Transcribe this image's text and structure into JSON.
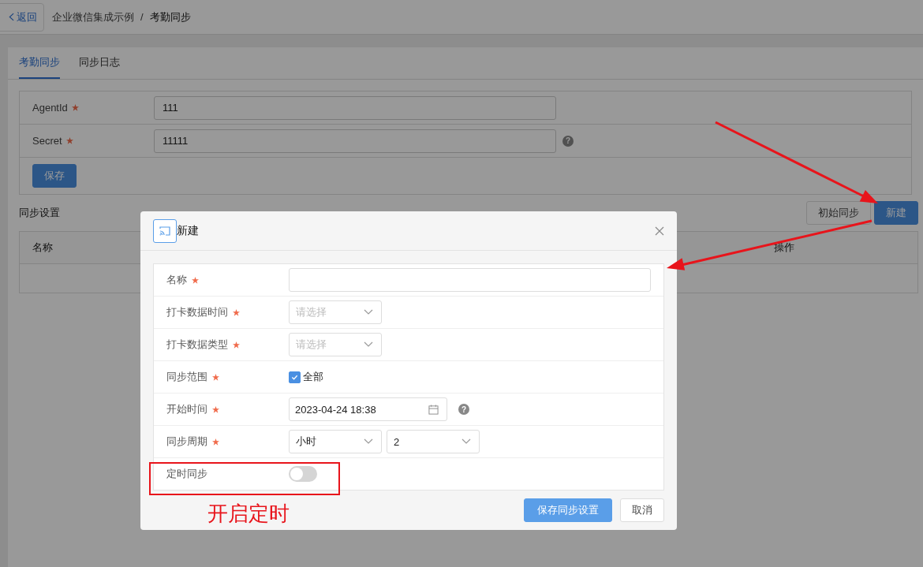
{
  "header": {
    "back": "返回",
    "breadcrumb": [
      "企业微信集成示例",
      "考勤同步"
    ],
    "separator": "/"
  },
  "tabs": [
    {
      "label": "考勤同步",
      "selected": true
    },
    {
      "label": "同步日志",
      "selected": false
    }
  ],
  "credentials": {
    "fields": [
      {
        "label": "AgentId",
        "required": true,
        "value": "111"
      },
      {
        "label": "Secret",
        "required": true,
        "value": "11111",
        "help": "?"
      }
    ],
    "save_button": "保存"
  },
  "sync_settings": {
    "title": "同步设置",
    "buttons": [
      {
        "label": "初始同步",
        "kind": "default"
      },
      {
        "label": "新建",
        "kind": "primary"
      }
    ],
    "table": {
      "columns": [
        "名称",
        "操作"
      ]
    }
  },
  "dialog": {
    "title": "新建",
    "fields": [
      {
        "label": "名称",
        "required": true,
        "kind": "text"
      },
      {
        "label": "打卡数据时间",
        "required": true,
        "kind": "select",
        "placeholder": "请选择"
      },
      {
        "label": "打卡数据类型",
        "required": true,
        "kind": "select",
        "placeholder": "请选择"
      },
      {
        "label": "同步范围",
        "required": true,
        "kind": "checkbox",
        "option": "全部",
        "checked": true
      },
      {
        "label": "开始时间",
        "required": true,
        "kind": "datetime",
        "value": "2023-04-24 18:38",
        "help": "?"
      },
      {
        "label": "同步周期",
        "required": true,
        "kind": "selects",
        "values": [
          "小时",
          "2"
        ]
      },
      {
        "label": "定时同步",
        "required": false,
        "kind": "switch",
        "on": false
      }
    ],
    "buttons": [
      {
        "label": "保存同步设置",
        "kind": "primary"
      },
      {
        "label": "取消",
        "kind": "default"
      }
    ]
  },
  "annotation": {
    "text": "开启定时"
  }
}
